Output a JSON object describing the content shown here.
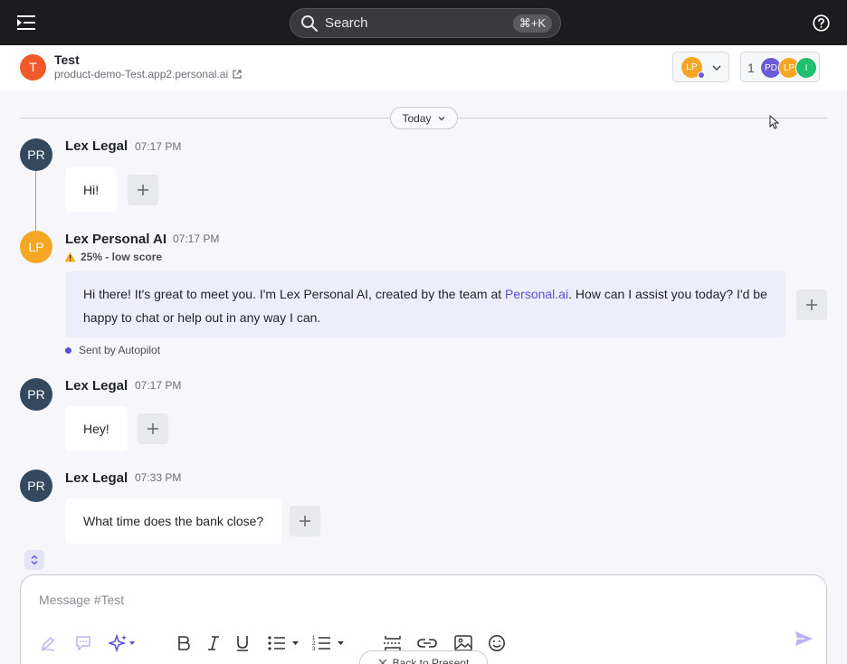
{
  "topbar": {
    "search_label": "Search",
    "search_shortcut": "⌘+K",
    "icons": [
      "sidebar-toggle-icon",
      "search-icon",
      "help-icon"
    ]
  },
  "channel": {
    "avatar_letter": "T",
    "title": "Test",
    "url": "product-demo-Test.app2.personal.ai",
    "persona_initials": "LP",
    "member_count": "1",
    "members": [
      "PD",
      "LP",
      "I"
    ]
  },
  "divider": {
    "label": "Today"
  },
  "messages": [
    {
      "initials": "PR",
      "author": "Lex Legal",
      "time": "07:17 PM",
      "text": "Hi!"
    },
    {
      "initials": "LP",
      "author": "Lex Personal AI",
      "time": "07:17 PM",
      "score": "25% - low score",
      "text_before": "Hi there! It's great to meet you. I'm Lex Personal AI, created by the team at ",
      "link": "Personal.ai",
      "text_after": ". How can I assist you today? I'd be happy to chat or help out in any way I can.",
      "footer": "Sent by Autopilot"
    },
    {
      "initials": "PR",
      "author": "Lex Legal",
      "time": "07:17 PM",
      "text": "Hey!"
    },
    {
      "initials": "PR",
      "author": "Lex Legal",
      "time": "07:33 PM",
      "text": "What time does the bank close?"
    }
  ],
  "composer": {
    "placeholder": "Message #Test",
    "tools": [
      "pen-icon",
      "comment-icon",
      "sparkle-icon",
      "bold-icon",
      "italic-icon",
      "underline-icon",
      "bullet-list-icon",
      "numbered-list-icon",
      "divider-icon",
      "link-icon",
      "image-icon",
      "emoji-icon",
      "send-icon"
    ]
  },
  "overlay": {
    "back_label": "Back to Present"
  },
  "colors": {
    "topbar": "#1c1c1e",
    "accent": "#5b4fd6",
    "channel_avatar": "#f05a28",
    "persona_avatar": "#f5a623",
    "user_avatar": "#34495e",
    "ai_bubble": "#eeedfb"
  }
}
